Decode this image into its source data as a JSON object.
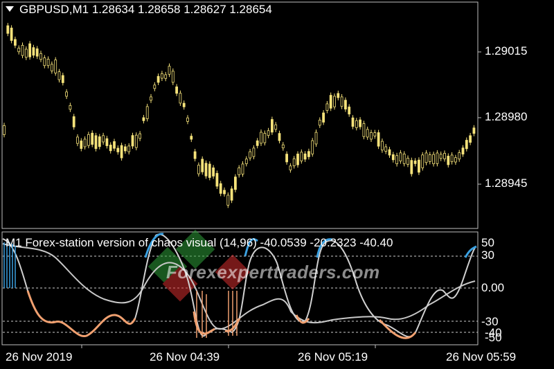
{
  "header": {
    "title": "GBPUSD,M1  1.28634 1.28658 1.28627 1.28654"
  },
  "price_axis": {
    "labels": [
      "1.29015",
      "1.28980",
      "1.28945"
    ]
  },
  "indicator": {
    "title": "M1 Forex-station version of chaos visual (14,96) -40.0539 -20.2323 -40.40",
    "axis_labels": [
      "50",
      "30",
      "0.00",
      "-30",
      "-40",
      "-50"
    ]
  },
  "time_axis": {
    "labels": [
      "26 Nov 2019",
      "26 Nov 04:39",
      "26 Nov 05:19",
      "26 Nov 05:59"
    ]
  },
  "watermark": {
    "text": "Forexexperttraders.com"
  },
  "colors": {
    "candle": "#f5e27a",
    "grid": "#bfbfbf",
    "upper": "#3aa0e0",
    "lower": "#f0a070",
    "slow": "#c8c8c8"
  }
}
